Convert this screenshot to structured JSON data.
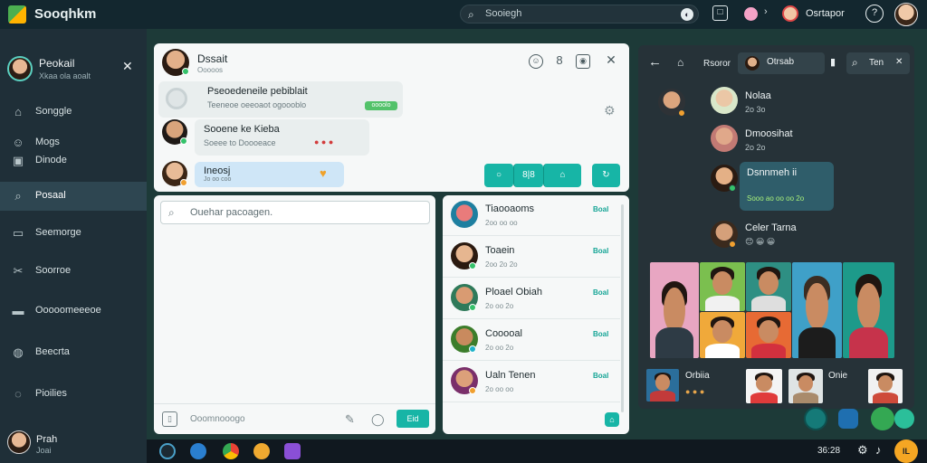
{
  "app": {
    "title": "Sooqhkm"
  },
  "topbar": {
    "search_text": "Sooiegh",
    "user_name": "Osrtapor",
    "help_label": "?"
  },
  "sidebar": {
    "user": {
      "name": "Peokail",
      "subtitle": "Xkaa ola aoalt"
    },
    "items": [
      {
        "label": "Songgle",
        "icon": "home-icon"
      },
      {
        "label": "Mogs",
        "icon": "people-icon"
      },
      {
        "label": "Dinode",
        "icon": "image-icon"
      },
      {
        "label": "Posaal",
        "icon": "search-icon",
        "active": true
      },
      {
        "label": "Seemorge",
        "icon": "chat-icon"
      },
      {
        "label": "Soorroe",
        "icon": "tools-icon"
      },
      {
        "label": "Ooooomeeeoe",
        "icon": "folder-icon"
      },
      {
        "label": "Beecrta",
        "icon": "globe-icon"
      },
      {
        "label": "Pioilies",
        "icon": "pin-icon"
      }
    ],
    "footer": {
      "name": "Prah",
      "subtitle": "Joai"
    }
  },
  "chat": {
    "header": {
      "name": "Dssait",
      "subtitle": "Ooooos"
    },
    "messages": [
      {
        "title": "Pseoedeneile pebiblait",
        "subtitle": "Teeneoe oeeoaot ogoooblo",
        "tag": "oooolo"
      },
      {
        "title": "Sooene ke Kieba",
        "subtitle": "Soeee to Doooeace"
      },
      {
        "title": "Ineosj",
        "subtitle": "Jo oo coo"
      }
    ],
    "actions": {
      "btn_a": "○",
      "btn_b": "8|8",
      "btn_c": "⌂",
      "btn_d": "↻"
    }
  },
  "compose": {
    "search_placeholder": "Ouehar pacoagen.",
    "message_placeholder": "Ooomnooogo",
    "send_label": "Eid"
  },
  "contacts": [
    {
      "name": "Tiaooaoms",
      "status": "2oo oo oo",
      "tag": "Boal"
    },
    {
      "name": "Toaein",
      "status": "2oo 2o 2o",
      "tag": "Boal"
    },
    {
      "name": "Ploael Obiah",
      "status": "2o oo 2o",
      "tag": "Boal"
    },
    {
      "name": "Cooooal",
      "status": "2o oo 2o",
      "tag": "Boal"
    },
    {
      "name": "Ualn Tenen",
      "status": "2o oo oo",
      "tag": "Boal"
    }
  ],
  "right_panel": {
    "tabs": {
      "a": "Rsoror",
      "b": "Otrsab",
      "c": "Ten"
    },
    "messages": [
      {
        "name": "Nolaa",
        "status": "2o 3o"
      },
      {
        "name": "Dmoosihat",
        "status": "2o 2o"
      },
      {
        "name": "Dsnnmeh ii",
        "status": "Sooo ao oo oo 2o"
      },
      {
        "name": "Celer Tarna",
        "status": "😊 😀 😀"
      }
    ],
    "gallery_labels": {
      "a": "Orbiia",
      "b": "Onie"
    }
  },
  "taskbar": {
    "time": "36:28",
    "orange_label": "IL"
  },
  "colors": {
    "accent": "#17b5a6",
    "sidebar": "#1f2f38",
    "dark_panel": "#263238"
  }
}
